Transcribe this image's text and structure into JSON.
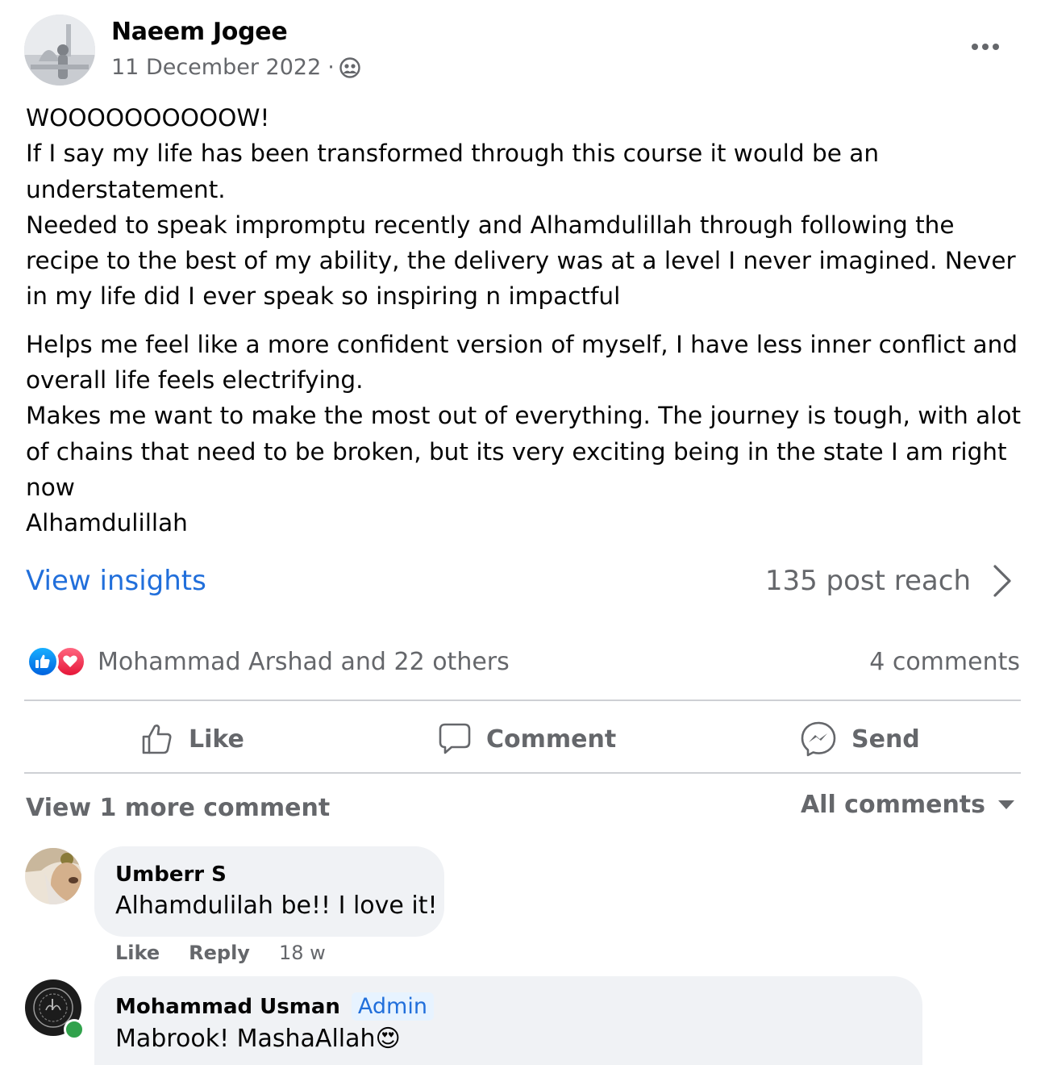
{
  "post": {
    "author": "Naeem Jogee",
    "date": "11 December 2022",
    "separator": "·",
    "audience_icon": "friends-audience-icon",
    "more_icon": "more-options-icon",
    "body": {
      "line1": "WOOOOOOOOOOW!",
      "line2": "If I say my life has been transformed through this course it would be an understatement.",
      "line3": "Needed to speak impromptu recently and Alhamdulillah through following the recipe to the best of my ability, the delivery was at a level I never imagined. Never in my life did I ever speak so inspiring n impactful",
      "line4": "Helps me feel like a more confident version of myself, I have less inner conflict and overall life feels electrifying.",
      "line5": "Makes me want to make the most out of everything. The journey is tough, with alot of chains that need to be broken, but its very exciting being in the state I am right now",
      "line6": "Alhamdulillah"
    }
  },
  "insights": {
    "link_label": "View insights",
    "reach_label": "135 post reach"
  },
  "reactions": {
    "icons": [
      "like-reaction-icon",
      "love-reaction-icon"
    ],
    "summary": "Mohammad Arshad and 22 others",
    "comments_count": "4 comments"
  },
  "actions": {
    "like": "Like",
    "comment": "Comment",
    "send": "Send"
  },
  "comments_section": {
    "view_more": "View 1 more comment",
    "filter": "All comments",
    "comments": [
      {
        "name": "Umberr S",
        "text": "Alhamdulilah be!! I love it!",
        "like": "Like",
        "reply": "Reply",
        "time": "18 w"
      },
      {
        "name": "Mohammad Usman",
        "badge": "Admin",
        "text": "Mabrook! MashaAllah",
        "emoji": "😍"
      }
    ]
  },
  "colors": {
    "link_blue": "#216fdb",
    "secondary_text": "#65676b",
    "bubble_bg": "#f0f2f5",
    "online_green": "#31a24c"
  }
}
